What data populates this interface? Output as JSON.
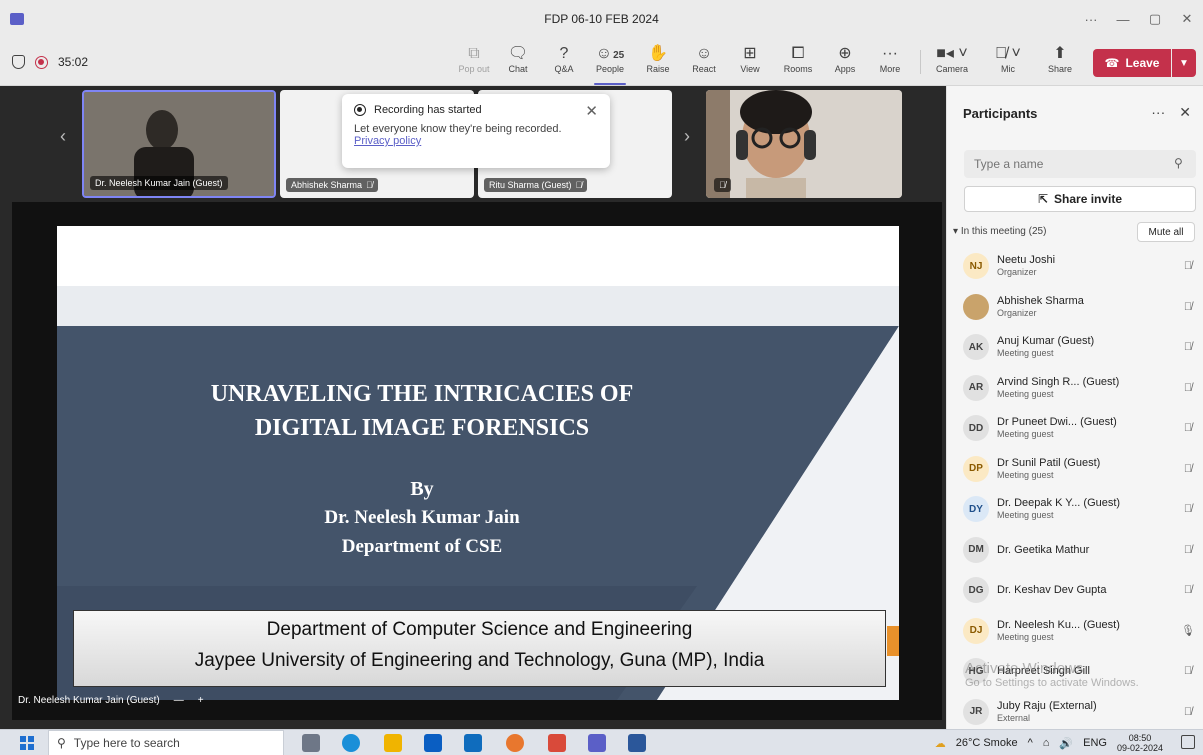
{
  "window": {
    "title": "FDP 06-10 FEB 2024",
    "controls": [
      "···",
      "—",
      "▢",
      "✕"
    ]
  },
  "toolbar": {
    "timer": "35:02",
    "buttons": [
      {
        "label": "Pop out",
        "icon": "pop-out-icon"
      },
      {
        "label": "Chat",
        "icon": "chat-icon"
      },
      {
        "label": "Q&A",
        "icon": "qa-icon"
      },
      {
        "label": "People",
        "icon": "people-icon",
        "count": "25"
      },
      {
        "label": "Raise",
        "icon": "raise-hand-icon"
      },
      {
        "label": "React",
        "icon": "react-icon"
      },
      {
        "label": "View",
        "icon": "view-icon"
      },
      {
        "label": "Rooms",
        "icon": "rooms-icon"
      },
      {
        "label": "Apps",
        "icon": "apps-icon"
      },
      {
        "label": "More",
        "icon": "more-icon"
      },
      {
        "label": "Camera",
        "icon": "camera-icon"
      },
      {
        "label": "Mic",
        "icon": "mic-off-icon"
      },
      {
        "label": "Share",
        "icon": "share-icon"
      }
    ],
    "leave_label": "Leave",
    "accent": "#5b5fc7",
    "leave_color": "#c4314b"
  },
  "thumbnails": [
    {
      "name": "Dr. Neelesh Kumar Jain (Guest)"
    },
    {
      "name": "Abhishek Sharma"
    },
    {
      "name": "Ritu Sharma (Guest)"
    }
  ],
  "toast": {
    "title": "Recording has started",
    "message": "Let everyone know they're being recorded.",
    "link": "Privacy policy"
  },
  "slide": {
    "title_line1": "UNRAVELING THE INTRICACIES OF",
    "title_line2": "DIGITAL IMAGE FORENSICS",
    "by": "By",
    "author": "Dr. Neelesh Kumar Jain",
    "dept": "Department of CSE",
    "footer_line1": "Department of Computer Science and Engineering",
    "footer_line2": "Jaypee University of Engineering and Technology, Guna (MP), India",
    "presenter_label": "Dr. Neelesh Kumar Jain (Guest)"
  },
  "panel": {
    "title": "Participants",
    "search_placeholder": "Type a name",
    "share_invite": "Share invite",
    "section": "In this meeting (25)",
    "mute_all": "Mute all",
    "participants": [
      {
        "initials": "NJ",
        "name": "Neetu Joshi",
        "role": "Organizer",
        "color": "#fbe9c4",
        "text": "#8a5a00",
        "mic": "muted"
      },
      {
        "initials": "",
        "name": "Abhishek Sharma",
        "role": "Organizer",
        "color": "#c9a36b",
        "text": "#fff",
        "mic": "muted"
      },
      {
        "initials": "AK",
        "name": "Anuj Kumar (Guest)",
        "role": "Meeting guest",
        "color": "#e1e1e1",
        "text": "#424242",
        "mic": "muted"
      },
      {
        "initials": "AR",
        "name": "Arvind Singh R... (Guest)",
        "role": "Meeting guest",
        "color": "#e1e1e1",
        "text": "#424242",
        "mic": "muted"
      },
      {
        "initials": "DD",
        "name": "Dr Puneet Dwi... (Guest)",
        "role": "Meeting guest",
        "color": "#e1e1e1",
        "text": "#424242",
        "mic": "muted"
      },
      {
        "initials": "DP",
        "name": "Dr Sunil Patil (Guest)",
        "role": "Meeting guest",
        "color": "#fbe9c4",
        "text": "#8a5a00",
        "mic": "muted"
      },
      {
        "initials": "DY",
        "name": "Dr. Deepak K Y... (Guest)",
        "role": "Meeting guest",
        "color": "#dbe8f6",
        "text": "#1f4f8a",
        "mic": "muted"
      },
      {
        "initials": "DM",
        "name": "Dr. Geetika Mathur",
        "role": "",
        "color": "#e1e1e1",
        "text": "#424242",
        "mic": "muted"
      },
      {
        "initials": "DG",
        "name": "Dr. Keshav Dev Gupta",
        "role": "",
        "color": "#e1e1e1",
        "text": "#424242",
        "mic": "muted"
      },
      {
        "initials": "DJ",
        "name": "Dr. Neelesh Ku... (Guest)",
        "role": "Meeting guest",
        "color": "#fbe9c4",
        "text": "#8a5a00",
        "mic": "on"
      },
      {
        "initials": "HG",
        "name": "Harpreet Singh Gill",
        "role": "",
        "color": "#e1e1e1",
        "text": "#424242",
        "mic": "muted"
      },
      {
        "initials": "JR",
        "name": "Juby Raju (External)",
        "role": "External",
        "color": "#e1e1e1",
        "text": "#424242",
        "mic": "muted"
      }
    ]
  },
  "watermark": {
    "line1": "Activate Windows",
    "line2": "Go to Settings to activate Windows."
  },
  "taskbar": {
    "search_placeholder": "Type here to search",
    "weather": "26°C Smoke",
    "lang": "ENG",
    "time": "08:50",
    "date": "09-02-2024"
  }
}
